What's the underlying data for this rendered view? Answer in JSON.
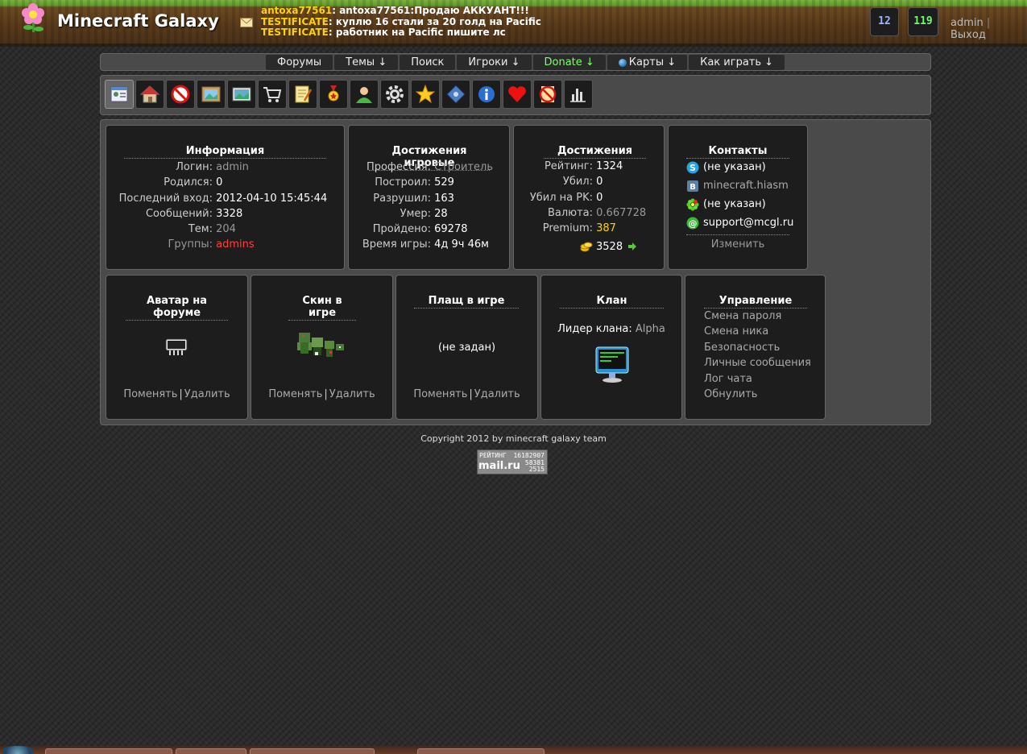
{
  "header": {
    "title": "Minecraft Galaxy",
    "chat": [
      {
        "nick": "antoxa77561",
        "text": ": antoxa77561:Продаю АККУАНТ!!!"
      },
      {
        "nick": "TESTIFICATE",
        "text": ": куплю 16 стали за 20 голд на Pacific"
      },
      {
        "nick": "TESTIFICATE",
        "text": ": работник на Pacific пишите лс"
      }
    ],
    "counter_1": "12",
    "counter_2": "119",
    "username": "admin",
    "separator": "|",
    "logout": "Выход"
  },
  "nav": {
    "items": [
      "Форумы",
      "Темы ↓",
      "Поиск",
      "Игроки ↓",
      "Donate ↓",
      "Карты ↓",
      "Как играть ↓"
    ]
  },
  "toolbar": {
    "icons": [
      "profile-card-icon",
      "house-icon",
      "ban-icon",
      "picture-frame-icon",
      "landscape-image-icon",
      "cart-icon",
      "notepad-icon",
      "medal-icon",
      "user-icon",
      "gear-icon",
      "star-icon",
      "puzzle-icon",
      "info-icon",
      "heart-icon",
      "no-writing-icon",
      "bar-chart-icon"
    ]
  },
  "info": {
    "title": "Информация",
    "rows": [
      {
        "k": "Логин:",
        "v": "admin"
      },
      {
        "k": "Родился:",
        "v": "0"
      },
      {
        "k": "Последний вход:",
        "v": "2012-04-10 15:45:44"
      },
      {
        "k": "Сообщений:",
        "v": "3328"
      },
      {
        "k": "Тем:",
        "v": "204"
      },
      {
        "k": "Группы:",
        "v": "admins"
      }
    ]
  },
  "game_achievements": {
    "title": "Достижения игровые",
    "rows": [
      {
        "k": "Профессия:",
        "v": "Строитель"
      },
      {
        "k": "Построил:",
        "v": "529"
      },
      {
        "k": "Разрушил:",
        "v": "163"
      },
      {
        "k": "Умер:",
        "v": "28"
      },
      {
        "k": "Пройдено:",
        "v": "69278"
      },
      {
        "k": "Время игры:",
        "v": "4д 9ч 46м"
      }
    ]
  },
  "achievements": {
    "title": "Достижения",
    "rows": [
      {
        "k": "Рейтинг:",
        "v": "1324"
      },
      {
        "k": "Убил:",
        "v": "0"
      },
      {
        "k": "Убил на PK:",
        "v": "0"
      },
      {
        "k": "Валюта:",
        "v": "0.667728"
      },
      {
        "k": "Premium:",
        "v": "387"
      }
    ],
    "coins": "3528"
  },
  "contacts": {
    "title": "Контакты",
    "skype": "(не указан)",
    "vk": "minecraft.hiasm",
    "icq": "(не указан)",
    "email": "support@mcgl.ru",
    "edit": "Изменить"
  },
  "avatar": {
    "title": "Аватар на форуме",
    "change": "Поменять",
    "sep": "|",
    "delete": "Удалить"
  },
  "skin": {
    "title": "Скин в игре",
    "change": "Поменять",
    "sep": "|",
    "delete": "Удалить"
  },
  "cloak": {
    "title": "Плащ в игре",
    "value": "(не задан)",
    "change": "Поменять",
    "sep": "|",
    "delete": "Удалить"
  },
  "clan": {
    "title": "Клан",
    "leader_label": "Лидер клана:",
    "leader_value": "Alpha"
  },
  "management": {
    "title": "Управление",
    "items": [
      "Смена пароля",
      "Смена ника",
      "Безопасность",
      "Личные сообщения",
      "Лог чата",
      "Обнулить"
    ]
  },
  "footer": {
    "copyright": "Copyright 2012 by minecraft galaxy team",
    "counter_label": "РЕЙТИНГ",
    "counter_num1": "16182907",
    "counter_brand": "mail.ru",
    "counter_num2": "58381",
    "counter_num3": "2515"
  }
}
